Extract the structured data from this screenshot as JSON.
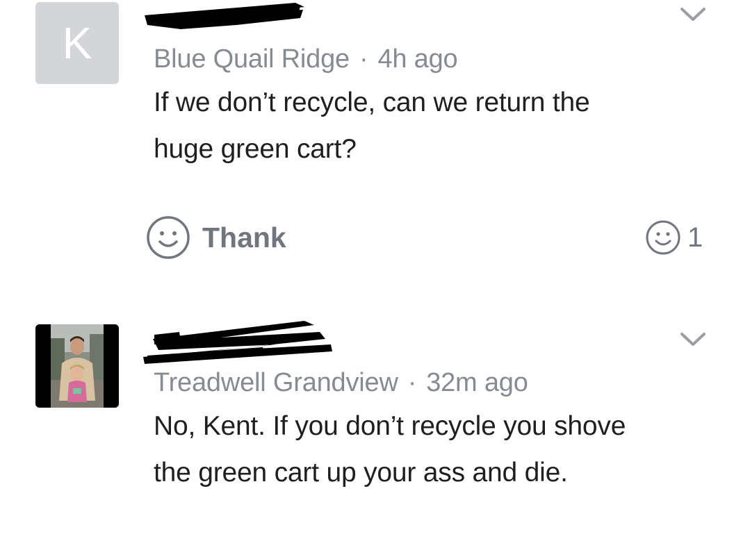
{
  "posts": [
    {
      "avatar_initial": "K",
      "author_name": "[redacted]",
      "neighborhood": "Blue Quail Ridge",
      "separator": "·",
      "time": "4h ago",
      "body": "If we don’t recycle, can we return the huge green cart?",
      "icons": {
        "menu": "chevron-down-icon",
        "thank": "smiley-icon",
        "thank_count": "smiley-icon"
      },
      "thank_label": "Thank",
      "thank_count": "1"
    },
    {
      "avatar": "profile-photo",
      "author_name": "[redacted]",
      "neighborhood": "Treadwell Grandview",
      "separator": "·",
      "time": "32m ago",
      "body": "No, Kent. If you don’t recycle you shove the green cart up your ass and die.",
      "icons": {
        "menu": "chevron-down-icon"
      }
    }
  ],
  "colors": {
    "meta_gray": "#868a91",
    "icon_gray": "#71757d",
    "avatar_bg": "#d4d5d8",
    "redaction": "#000000"
  }
}
